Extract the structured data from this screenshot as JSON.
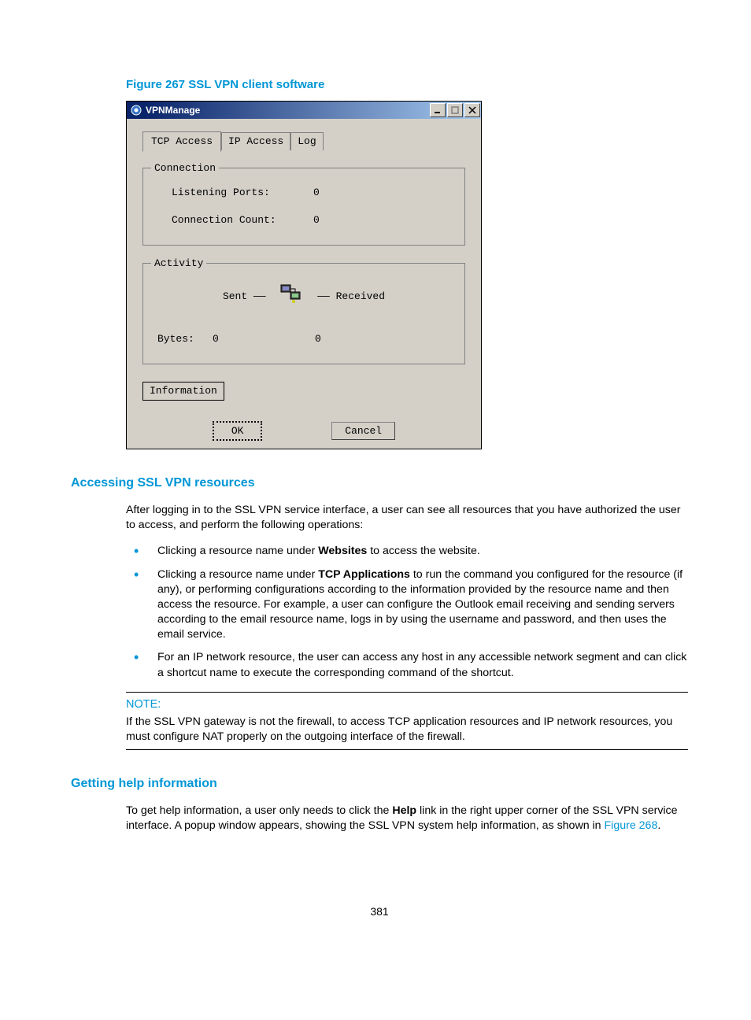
{
  "figure_caption": "Figure 267 SSL VPN client software",
  "dialog": {
    "title": "VPNManage",
    "tabs": {
      "tcp": "TCP Access",
      "ip": "IP Access",
      "log": "Log"
    },
    "connection": {
      "legend": "Connection",
      "listening_label": "Listening Ports:",
      "listening_value": "0",
      "count_label": "Connection Count:",
      "count_value": "0"
    },
    "activity": {
      "legend": "Activity",
      "sent": "Sent",
      "received": "Received",
      "bytes_label": "Bytes:",
      "bytes_sent": "0",
      "bytes_recv": "0"
    },
    "info_btn": "Information",
    "ok": "OK",
    "cancel": "Cancel"
  },
  "section1": {
    "heading": "Accessing SSL VPN resources",
    "intro": "After logging in to the SSL VPN service interface, a user can see all resources that you have authorized the user to access, and perform the following operations:",
    "bullet1_a": "Clicking a resource name under ",
    "bullet1_b": "Websites",
    "bullet1_c": " to access the website.",
    "bullet2_a": "Clicking a resource name under ",
    "bullet2_b": "TCP Applications",
    "bullet2_c": " to run the command you configured for the resource (if any), or performing configurations according to the information provided by the resource name and then access the resource. For example, a user can configure the Outlook email receiving and sending servers according to the email resource name, logs in by using the username and password, and then uses the email service.",
    "bullet3": "For an IP network resource, the user can access any host in any accessible network segment and can click a shortcut name to execute the corresponding command of the shortcut."
  },
  "note": {
    "label": "NOTE:",
    "text": "If the SSL VPN gateway is not the firewall, to access TCP application resources and IP network resources, you must configure NAT properly on the outgoing interface of the firewall."
  },
  "section2": {
    "heading": "Getting help information",
    "p_a": "To get help information, a user only needs to click the ",
    "p_b": "Help",
    "p_c": " link in the right upper corner of the SSL VPN service interface. A popup window appears, showing the SSL VPN system help information, as shown in ",
    "figref": "Figure 268",
    "p_end": "."
  },
  "page_number": "381"
}
